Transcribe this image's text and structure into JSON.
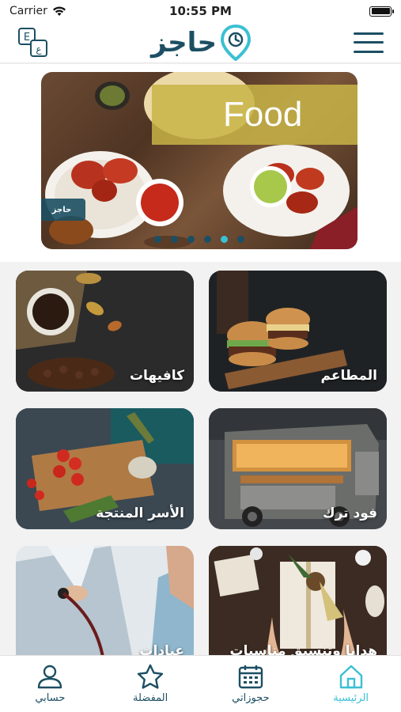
{
  "status": {
    "carrier": "Carrier",
    "time": "10:55 PM"
  },
  "header": {
    "logo_text": "حاجز"
  },
  "banner": {
    "title": "Food",
    "badge": "حاجز",
    "slide_count": 6,
    "active_slide": 4
  },
  "categories": [
    {
      "label": "كافيهات"
    },
    {
      "label": "المطاعم"
    },
    {
      "label": "الأسر المنتجة"
    },
    {
      "label": "فود ترك"
    },
    {
      "label": "عيادات"
    },
    {
      "label": "هدايا وتنسيق مناسبات"
    }
  ],
  "tabs": [
    {
      "label": "حسابي"
    },
    {
      "label": "المفضلة"
    },
    {
      "label": "حجوزاتي"
    },
    {
      "label": "الرئيسية"
    }
  ],
  "colors": {
    "brand": "#1c4f63",
    "accent": "#3ac0d3"
  },
  "icons": [
    "wifi-icon",
    "battery-icon",
    "language-icon",
    "menu-icon",
    "user-icon",
    "star-icon",
    "calendar-icon",
    "home-icon"
  ]
}
